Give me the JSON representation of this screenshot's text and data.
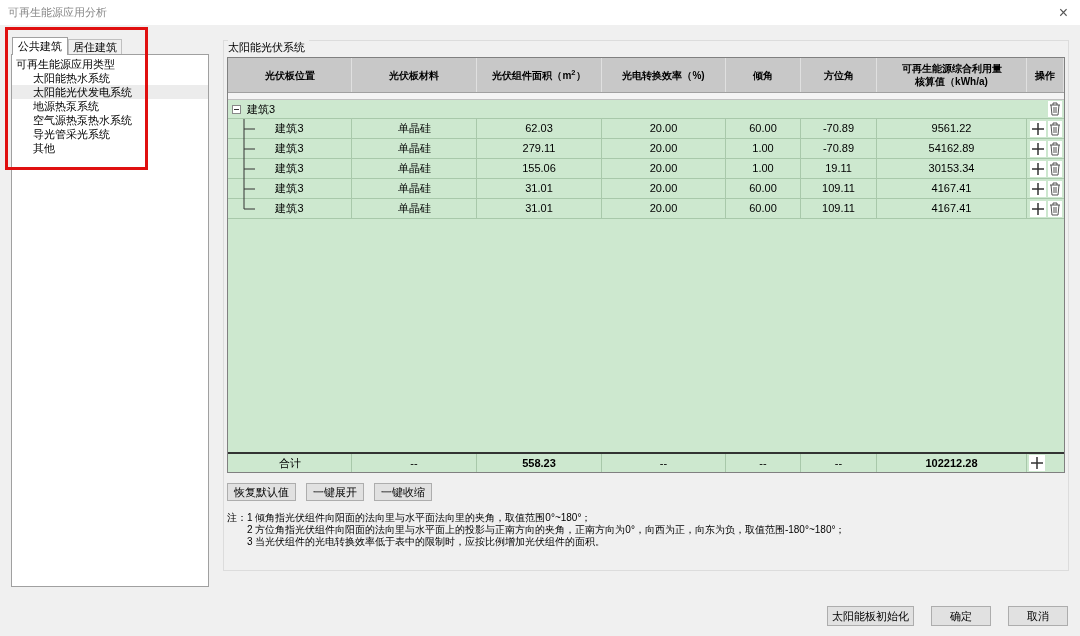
{
  "window": {
    "title": "可再生能源应用分析",
    "close": "×"
  },
  "tabs": [
    {
      "label": "公共建筑",
      "selected": true
    },
    {
      "label": "居住建筑",
      "selected": false
    }
  ],
  "tree": {
    "label": "可再生能源应用类型",
    "children": [
      {
        "label": "太阳能热水系统",
        "selected": false
      },
      {
        "label": "太阳能光伏发电系统",
        "selected": true
      },
      {
        "label": "地源热泵系统",
        "selected": false
      },
      {
        "label": "空气源热泵热水系统",
        "selected": false
      },
      {
        "label": "导光管采光系统",
        "selected": false
      },
      {
        "label": "其他",
        "selected": false
      }
    ]
  },
  "group_title": "太阳能光伏系统",
  "table": {
    "columns": [
      "光伏板位置",
      "光伏板材料",
      "光伏组件面积（m$^{2}$）",
      "光电转换效率（%)",
      "倾角",
      "方位角",
      "可再生能源综合利用量核算值（kWh/a)",
      "操作"
    ],
    "group": {
      "label": "建筑3",
      "expanded": true,
      "rows": [
        [
          "建筑3",
          "单晶硅",
          "62.03",
          "20.00",
          "60.00",
          "-70.89",
          "9561.22"
        ],
        [
          "建筑3",
          "单晶硅",
          "279.11",
          "20.00",
          "1.00",
          "-70.89",
          "54162.89"
        ],
        [
          "建筑3",
          "单晶硅",
          "155.06",
          "20.00",
          "1.00",
          "19.11",
          "30153.34"
        ],
        [
          "建筑3",
          "单晶硅",
          "31.01",
          "20.00",
          "60.00",
          "109.11",
          "4167.41"
        ],
        [
          "建筑3",
          "单晶硅",
          "31.01",
          "20.00",
          "60.00",
          "109.11",
          "4167.41"
        ]
      ]
    },
    "total": [
      "合计",
      "--",
      "558.23",
      "--",
      "--",
      "--",
      "102212.28"
    ]
  },
  "table_buttons": [
    "恢复默认值",
    "一键展开",
    "一键收缩"
  ],
  "notes": {
    "label": "注：",
    "lines": [
      "1 倾角指光伏组件向阳面的法向里与水平面法向里的夹角，取值范围0°~180°；",
      "2 方位角指光伏组件向阳面的法向里与水平面上的投影与正南方向的夹角，正南方向为0°，向西为正，向东为负，取值范围-180°~180°；",
      "3 当光伏组件的光电转换效率低于表中的限制时，应按比例增加光伏组件的面积。"
    ]
  },
  "footer_buttons": [
    "太阳能板初始化",
    "确定",
    "取消"
  ]
}
